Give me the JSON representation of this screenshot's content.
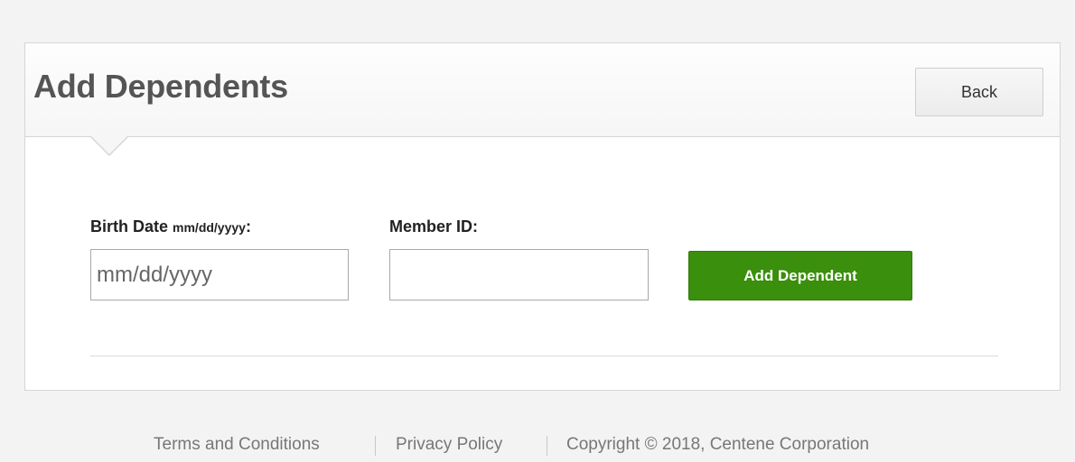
{
  "header": {
    "title": "Add Dependents",
    "back_label": "Back"
  },
  "form": {
    "birth_date": {
      "label": "Birth Date",
      "format_hint": "mm/dd/yyyy",
      "suffix": ":",
      "placeholder": "mm/dd/yyyy",
      "value": ""
    },
    "member_id": {
      "label": "Member ID:",
      "placeholder": "",
      "value": ""
    },
    "submit_label": "Add Dependent"
  },
  "footer": {
    "terms_label": "Terms and Conditions",
    "privacy_label": "Privacy Policy",
    "copyright": "Copyright © 2018, Centene Corporation"
  },
  "colors": {
    "background": "#f3f3f3",
    "panel": "#ffffff",
    "title": "#555555",
    "primary_button": "#3a8f0c",
    "footer_text": "#777777"
  }
}
